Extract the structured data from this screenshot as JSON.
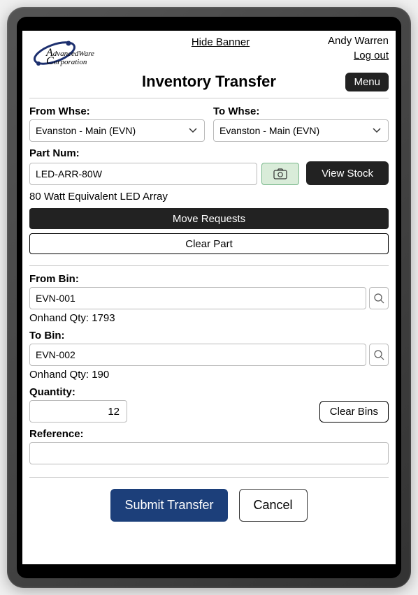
{
  "header": {
    "hide_banner": "Hide Banner",
    "user_name": "Andy Warren",
    "logout": "Log out",
    "logo_line1": "dvancedWare",
    "logo_line2": "orporation"
  },
  "page": {
    "title": "Inventory Transfer",
    "menu_label": "Menu"
  },
  "whse": {
    "from_label": "From Whse:",
    "from_value": "Evanston - Main (EVN)",
    "to_label": "To Whse:",
    "to_value": "Evanston - Main (EVN)"
  },
  "part": {
    "label": "Part Num:",
    "value": "LED-ARR-80W",
    "view_stock": "View Stock",
    "description": "80 Watt Equivalent LED Array",
    "move_requests": "Move Requests",
    "clear_part": "Clear Part"
  },
  "bins": {
    "from_label": "From Bin:",
    "from_value": "EVN-001",
    "from_onhand": "Onhand Qty: 1793",
    "to_label": "To Bin:",
    "to_value": "EVN-002",
    "to_onhand": "Onhand Qty: 190"
  },
  "qty": {
    "label": "Quantity:",
    "value": "12",
    "clear_bins": "Clear Bins"
  },
  "reference": {
    "label": "Reference:",
    "value": ""
  },
  "footer": {
    "submit": "Submit Transfer",
    "cancel": "Cancel"
  }
}
